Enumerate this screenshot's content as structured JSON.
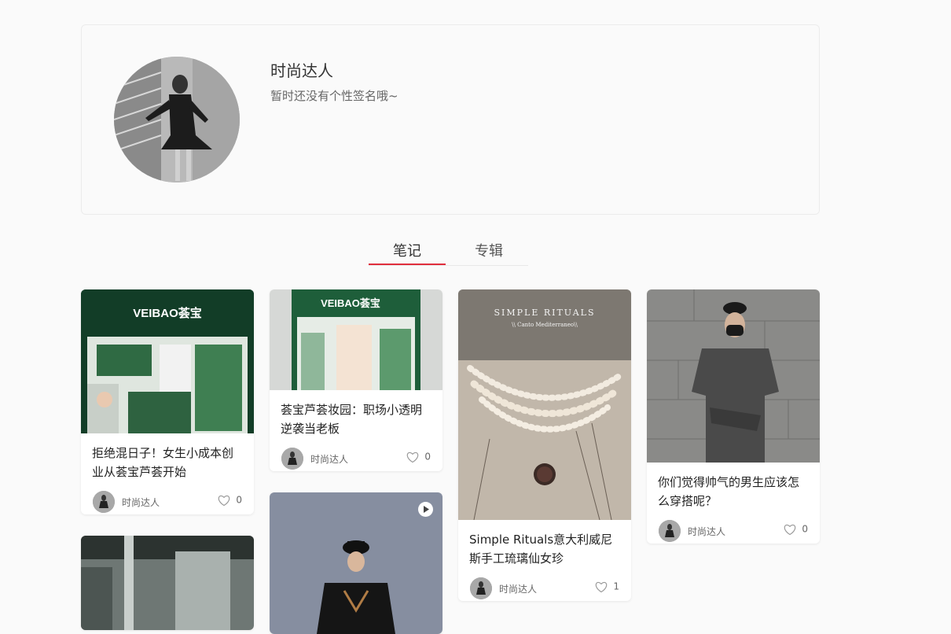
{
  "profile": {
    "name": "时尚达人",
    "signature": "暂时还没有个性签名哦~"
  },
  "tabs": [
    {
      "label": "笔记",
      "active": true
    },
    {
      "label": "专辑",
      "active": false
    }
  ],
  "colors": {
    "accent": "#e02e3d",
    "background": "#fafafa"
  },
  "notes": [
    {
      "title": "拒绝混日子！女生小成本创业从荟宝芦荟开始",
      "author": "时尚达人",
      "likes": "0",
      "cover_text": "VEIBAO荟宝"
    },
    {
      "title": "荟宝芦荟妆园：职场小透明逆袭当老板",
      "author": "时尚达人",
      "likes": "0",
      "cover_text": "VEIBAO荟宝"
    },
    {
      "title": "Simple Rituals意大利威尼斯手工琉璃仙女珍",
      "author": "时尚达人",
      "likes": "1",
      "cover_text": "SIMPLE RITUALS",
      "cover_subtext": "\\\\ Canto Mediterraneo\\\\"
    },
    {
      "title": "你们觉得帅气的男生应该怎么穿搭呢？",
      "author": "时尚达人",
      "likes": "0"
    },
    {
      "title": "",
      "author": "",
      "likes": ""
    },
    {
      "title": "",
      "author": "",
      "likes": ""
    }
  ]
}
